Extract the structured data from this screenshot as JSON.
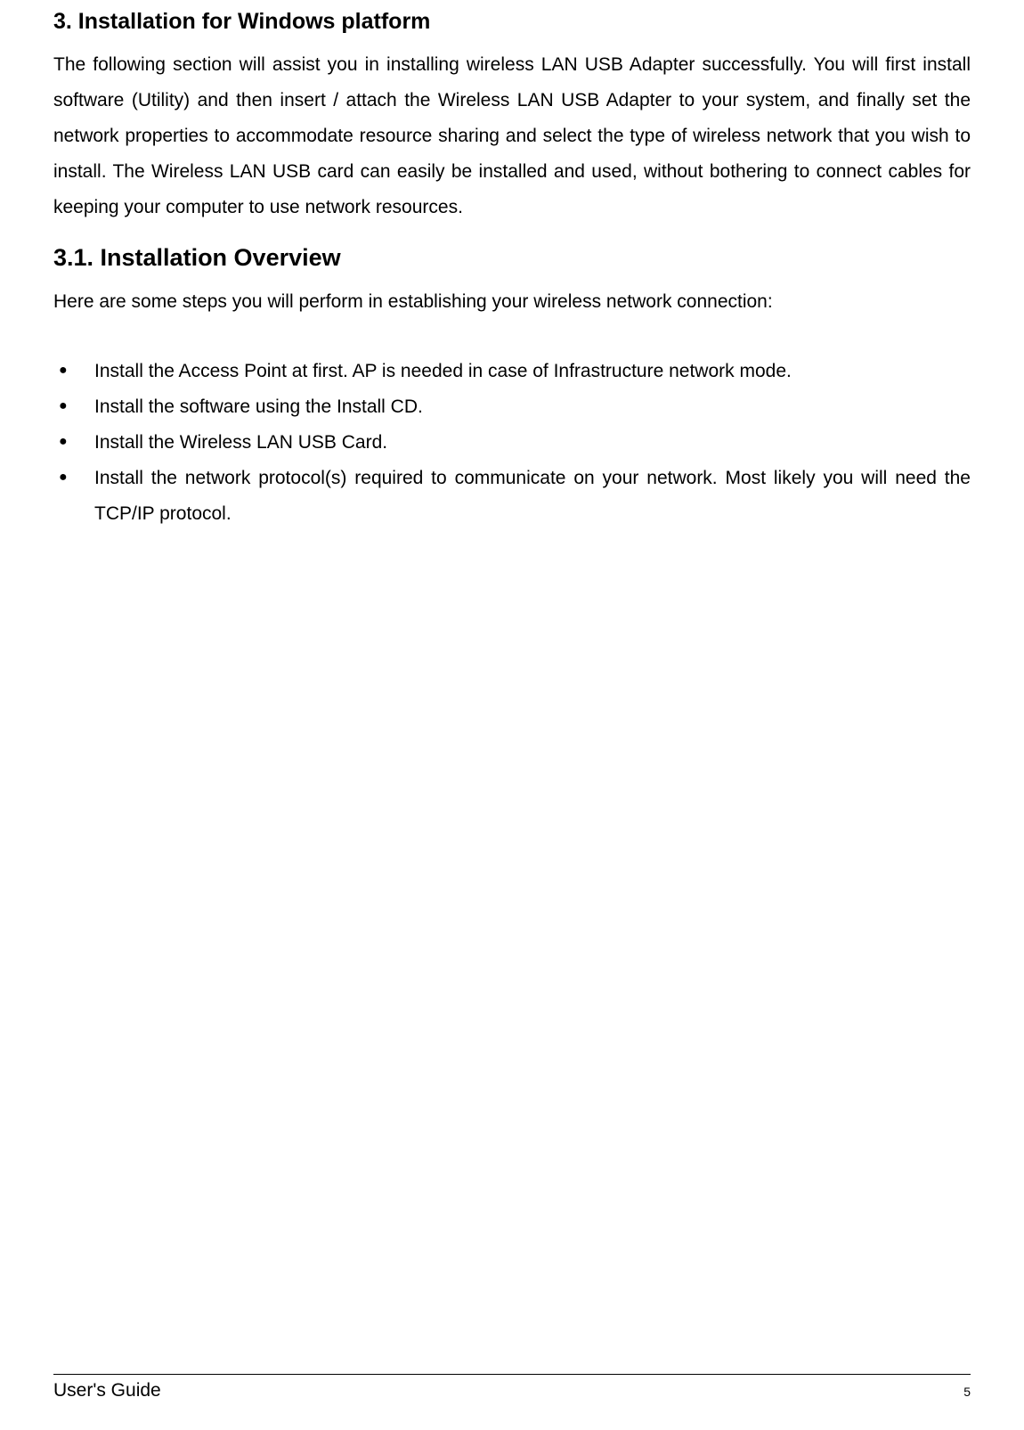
{
  "section3": {
    "title": "3. Installation for Windows platform",
    "paragraph": "The following section will assist you in installing wireless LAN USB Adapter successfully. You will first install software (Utility) and then insert / attach the Wireless LAN USB Adapter to your system, and finally set the network properties to accommodate resource sharing and select the type of wireless network that you wish to install. The Wireless LAN USB card can easily be installed and used, without bothering to connect cables for keeping your computer to use network resources."
  },
  "section3_1": {
    "title": "3.1. Installation Overview",
    "intro": "Here are some steps you will perform in establishing your wireless network connection:",
    "bullets": [
      "Install the Access Point at first. AP is needed in case of Infrastructure network mode.",
      "Install the software using the Install CD.",
      "Install the Wireless LAN USB Card.",
      "Install the network protocol(s) required to communicate on your network. Most likely you will need the TCP/IP protocol."
    ]
  },
  "footer": {
    "left": "User's Guide",
    "right": "5"
  }
}
